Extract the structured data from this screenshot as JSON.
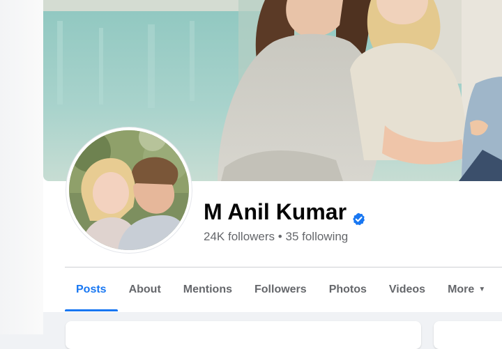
{
  "profile": {
    "name": "M Anil Kumar",
    "verified": true,
    "followers": "24K followers",
    "separator": "•",
    "following": "35 following"
  },
  "tabs": [
    {
      "label": "Posts",
      "active": true
    },
    {
      "label": "About",
      "active": false
    },
    {
      "label": "Mentions",
      "active": false
    },
    {
      "label": "Followers",
      "active": false
    },
    {
      "label": "Photos",
      "active": false
    },
    {
      "label": "Videos",
      "active": false
    },
    {
      "label": "More",
      "active": false
    }
  ],
  "colors": {
    "accent": "#1877f2",
    "name_text": "#050505",
    "secondary_text": "#65676b",
    "page_background": "#f0f2f5"
  },
  "icons": {
    "verified": "verified-badge-icon",
    "more": "caret-down-icon"
  }
}
